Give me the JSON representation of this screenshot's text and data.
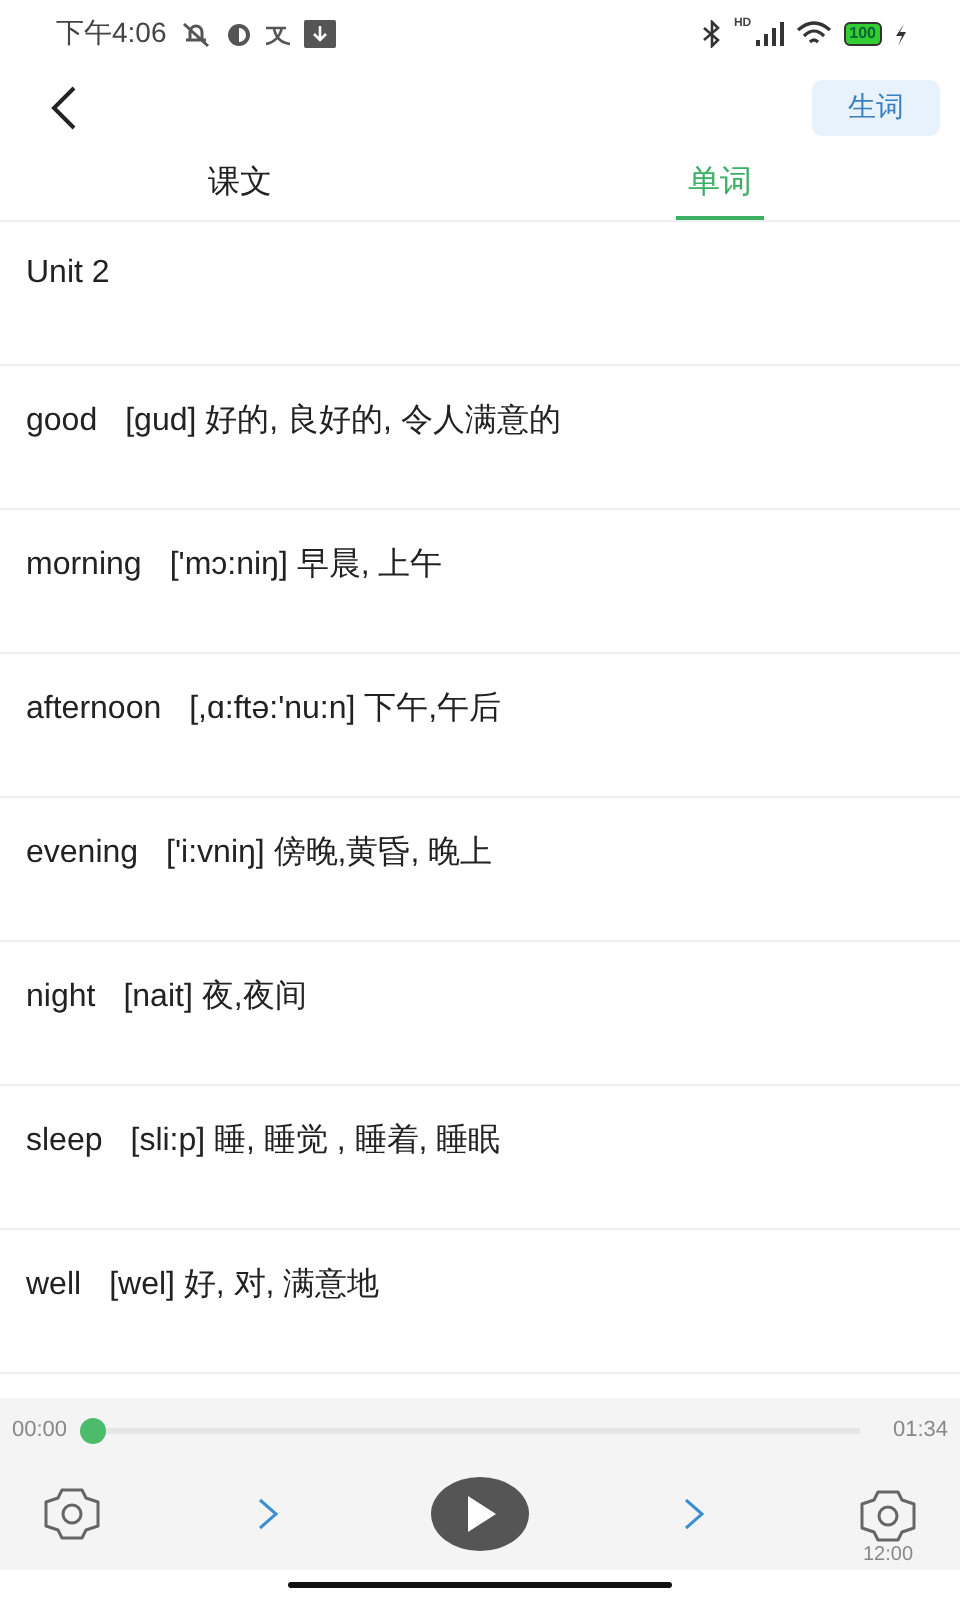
{
  "status_bar": {
    "time": "下午4:06",
    "network_label": "HD",
    "battery": "100"
  },
  "header": {
    "button": "生词"
  },
  "tabs": [
    {
      "label": "课文",
      "selected": false
    },
    {
      "label": "单词",
      "selected": true
    }
  ],
  "rows": [
    {
      "kind": "heading",
      "word": "Unit 2"
    },
    {
      "kind": "word",
      "word": "good",
      "definition": "[gud] 好的, 良好的, 令人满意的"
    },
    {
      "kind": "word",
      "word": "morning",
      "definition": "['mɔ:niŋ] 早晨, 上午"
    },
    {
      "kind": "word",
      "word": "afternoon",
      "definition": "[,ɑ:ftə:'nu:n] 下午,午后"
    },
    {
      "kind": "word",
      "word": "evening",
      "definition": "['i:vniŋ] 傍晚,黄昏, 晚上"
    },
    {
      "kind": "word",
      "word": "night",
      "definition": "[nait] 夜,夜间"
    },
    {
      "kind": "word",
      "word": "sleep",
      "definition": "[sli:p] 睡, 睡觉 , 睡着, 睡眠"
    },
    {
      "kind": "word",
      "word": "well",
      "definition": "[wel] 好, 对, 满意地"
    }
  ],
  "player": {
    "elapsed": "00:00",
    "duration": "01:34",
    "level": 0,
    "timer": "12:00"
  }
}
